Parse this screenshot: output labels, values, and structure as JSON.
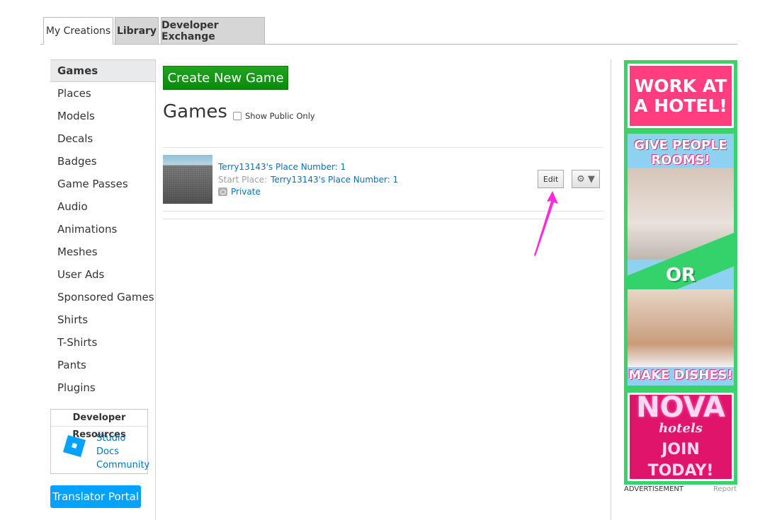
{
  "tabs": [
    {
      "label": "My Creations",
      "active": true
    },
    {
      "label": "Library"
    },
    {
      "label": "Developer Exchange"
    }
  ],
  "sidebar": {
    "items": [
      {
        "label": "Games",
        "active": true
      },
      {
        "label": "Places"
      },
      {
        "label": "Models"
      },
      {
        "label": "Decals"
      },
      {
        "label": "Badges"
      },
      {
        "label": "Game Passes"
      },
      {
        "label": "Audio"
      },
      {
        "label": "Animations"
      },
      {
        "label": "Meshes"
      },
      {
        "label": "User Ads"
      },
      {
        "label": "Sponsored Games"
      },
      {
        "label": "Shirts"
      },
      {
        "label": "T-Shirts"
      },
      {
        "label": "Pants"
      },
      {
        "label": "Plugins"
      }
    ],
    "developer_resources": {
      "title": "Developer Resources",
      "links": [
        "Studio",
        "Docs",
        "Community"
      ]
    },
    "translator_portal": "Translator Portal"
  },
  "main": {
    "create_button": "Create New Game",
    "heading": "Games",
    "public_only_label": "Show Public Only",
    "public_only_checked": false,
    "game": {
      "title": "Terry13143's Place Number: 1",
      "start_place_label": "Start Place:",
      "start_place_value": "Terry13143's Place Number: 1",
      "privacy": "Private",
      "edit_label": "Edit",
      "gear_label": "⚙ ▼"
    }
  },
  "ad": {
    "panel1": "WORK AT A HOTEL!",
    "panel2_top": "GIVE PEOPLE ROOMS!",
    "panel2_or": "OR",
    "panel2_bottom": "MAKE DISHES!",
    "panel3_brand": "NOVA",
    "panel3_sub": "hotels",
    "panel3_cta": "JOIN TODAY!",
    "label": "ADVERTISEMENT",
    "report": "Report"
  },
  "colors": {
    "link": "#0074bd",
    "create_button": "#0b8a0b",
    "translator_button": "#00a2ff",
    "annotation_arrow": "#ff2bd6"
  }
}
